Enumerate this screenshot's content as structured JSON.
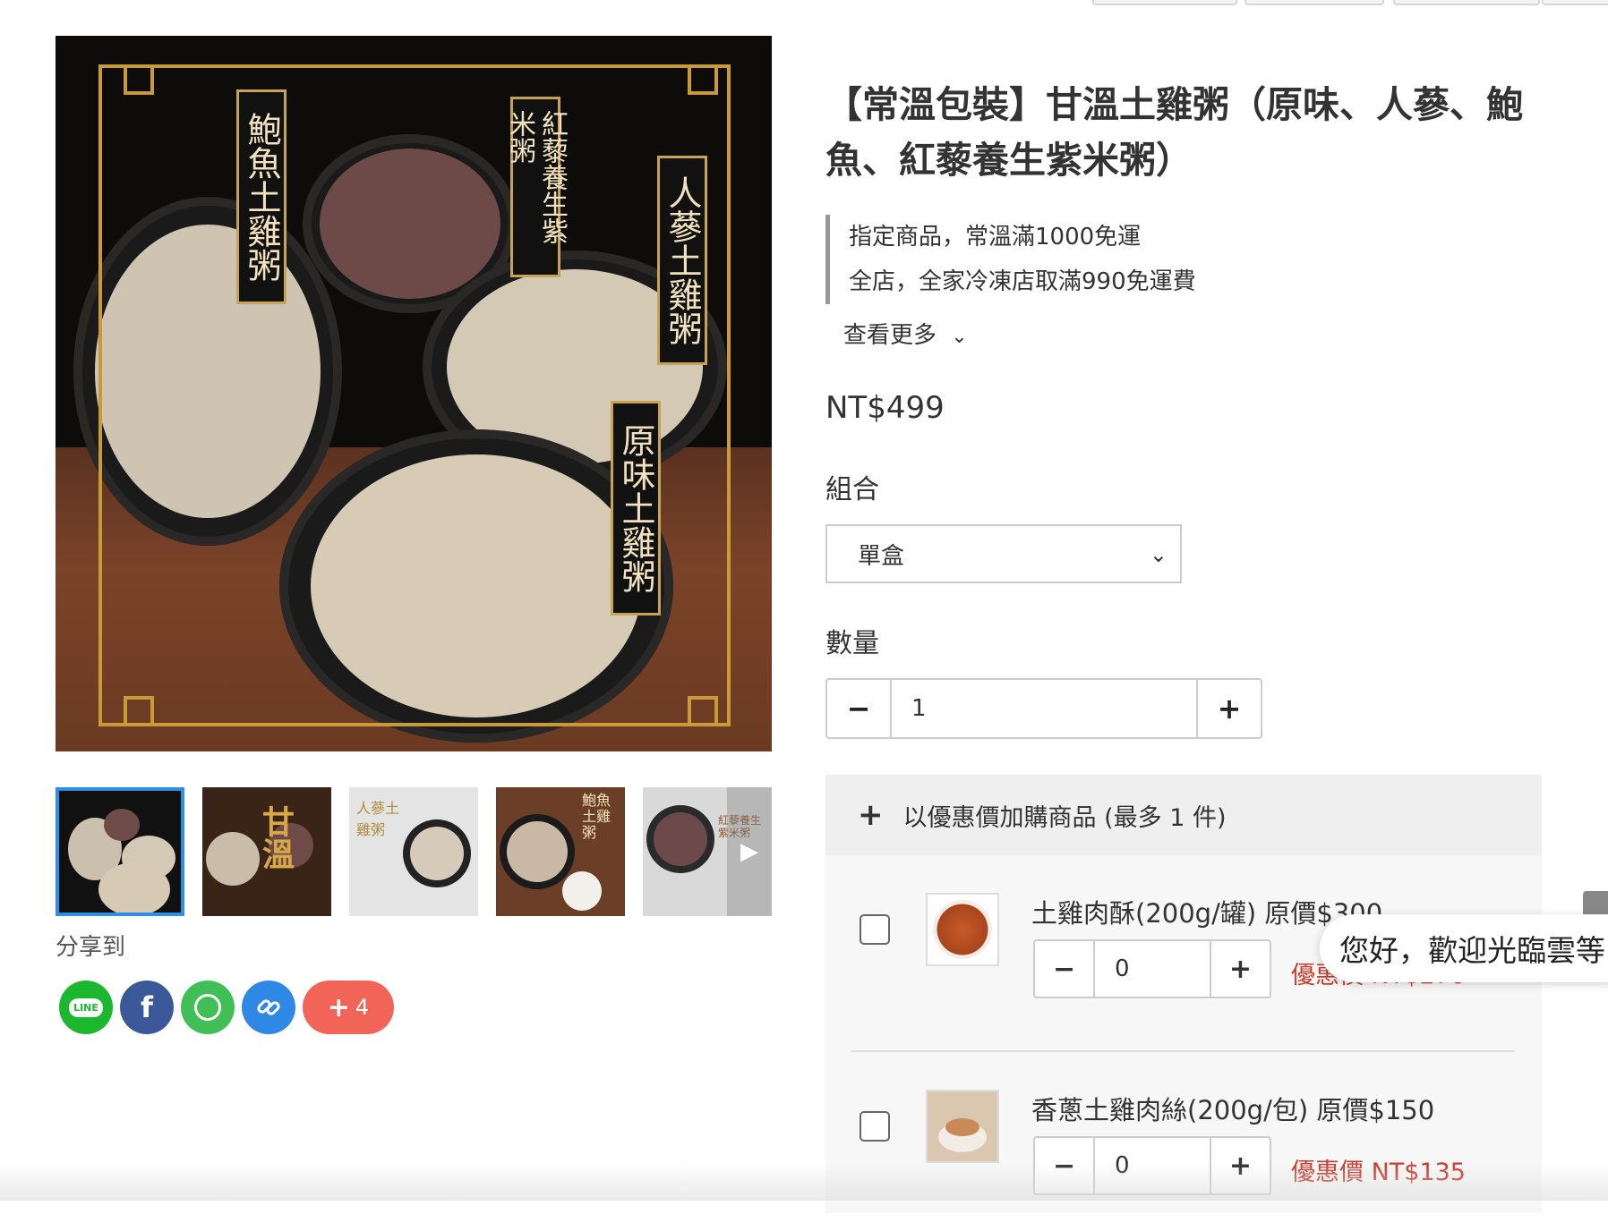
{
  "product": {
    "title": "【常溫包裝】甘溫土雞粥（原味、人蔘、鮑魚、紅藜養生紫米粥）",
    "notes": [
      "指定商品，常溫滿1000免運",
      "全店，全家冷凍店取滿990免運費"
    ],
    "see_more": "查看更多",
    "price": "NT$499",
    "option_label": "組合",
    "option_selected": "單盒",
    "quantity_label": "數量",
    "quantity_value": "1"
  },
  "main_image": {
    "labels": [
      "鮑魚土雞粥",
      "紅藜養生紫米粥",
      "人蔘土雞粥",
      "原味土雞粥"
    ]
  },
  "thumbnails": {
    "texts": [
      "甘溫",
      "人蔘土雞粥",
      "鮑魚土雞粥",
      "紅藜養生紫米粥"
    ]
  },
  "share": {
    "label": "分享到",
    "buttons": [
      "LINE",
      "f",
      "whatsapp",
      "link"
    ],
    "more_count": "4"
  },
  "addon": {
    "header": "以優惠價加購商品 (最多 1 件)",
    "items": [
      {
        "name": "土雞肉酥(200g/罐) 原價$300",
        "qty": "0",
        "promo": "優惠價 NT$270"
      },
      {
        "name": "香蔥土雞肉絲(200g/包) 原價$150",
        "qty": "0",
        "promo": "優惠價 NT$135"
      }
    ]
  },
  "chat": {
    "greeting": "您好，歡迎光臨雲等"
  },
  "icons": {
    "plus": "+",
    "minus": "−",
    "chevron": "⌄",
    "next": "▶"
  }
}
